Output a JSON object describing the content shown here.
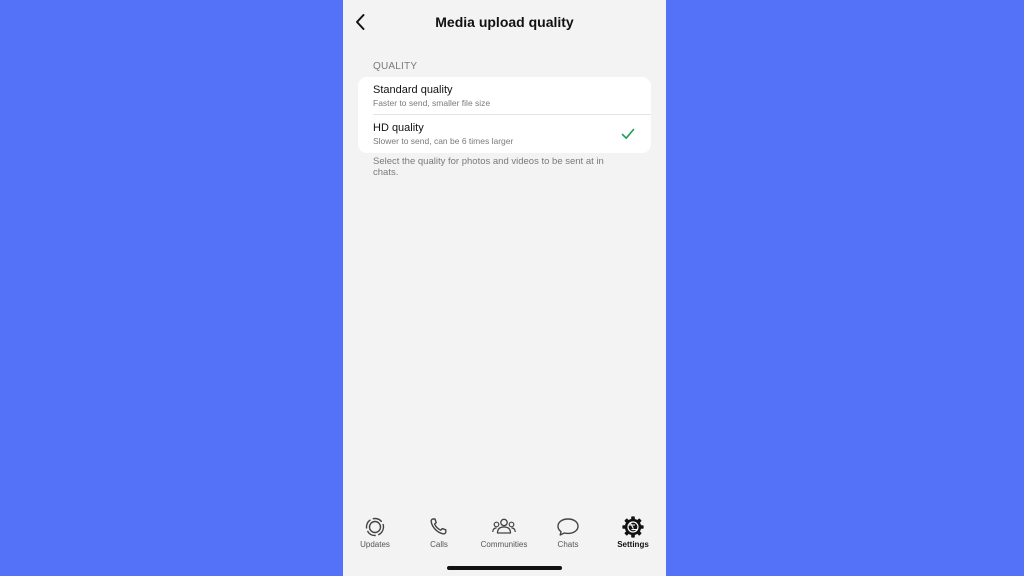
{
  "header": {
    "title": "Media upload quality",
    "back_icon": "chevron-left-icon"
  },
  "quality_section": {
    "header": "QUALITY",
    "options": [
      {
        "title": "Standard quality",
        "subtitle": "Faster to send, smaller file size",
        "selected": false
      },
      {
        "title": "HD quality",
        "subtitle": "Slower to send, can be 6 times larger",
        "selected": true
      }
    ],
    "footer": "Select the quality for photos and videos to be sent at in chats."
  },
  "tab_bar": {
    "tabs": [
      {
        "label": "Updates",
        "icon": "updates-icon",
        "active": false
      },
      {
        "label": "Calls",
        "icon": "phone-icon",
        "active": false
      },
      {
        "label": "Communities",
        "icon": "communities-icon",
        "active": false
      },
      {
        "label": "Chats",
        "icon": "chats-icon",
        "active": false
      },
      {
        "label": "Settings",
        "icon": "gear-icon",
        "active": true
      }
    ]
  },
  "colors": {
    "background": "#5472f8",
    "screen": "#f3f3f3",
    "card": "#ffffff",
    "check": "#1e9e5a"
  }
}
